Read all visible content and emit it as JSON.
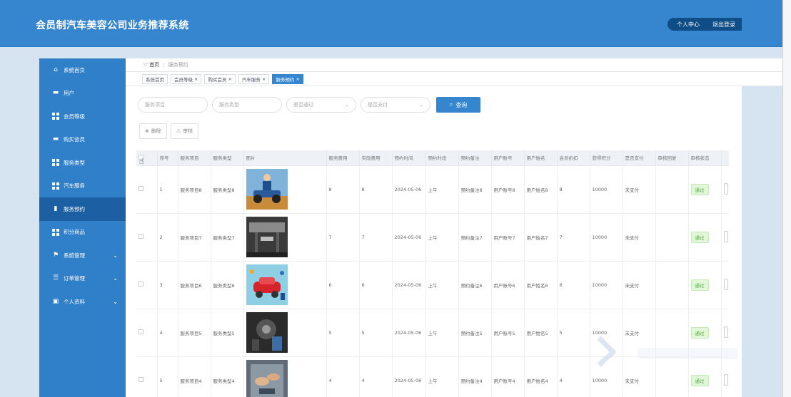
{
  "app": {
    "title": "会员制汽车美容公司业务推荐系统"
  },
  "header": {
    "profile": "个人中心",
    "logout": "退出登录"
  },
  "sidebar": {
    "items": [
      {
        "label": "系统首页",
        "icon": "home-icon"
      },
      {
        "label": "用户",
        "icon": "user-card-icon"
      },
      {
        "label": "会员等级",
        "icon": "grid-icon"
      },
      {
        "label": "购买会员",
        "icon": "user-card-icon"
      },
      {
        "label": "服务类型",
        "icon": "grid-icon"
      },
      {
        "label": "汽车服务",
        "icon": "grid-icon"
      },
      {
        "label": "服务预约",
        "icon": "book-icon",
        "active": true
      },
      {
        "label": "积分商品",
        "icon": "grid-icon"
      },
      {
        "label": "系统管理",
        "icon": "flag-icon",
        "expandable": true
      },
      {
        "label": "订单管理",
        "icon": "sliders-icon",
        "expandable": true
      },
      {
        "label": "个人资料",
        "icon": "wallet-icon",
        "expandable": true
      }
    ]
  },
  "breadcrumb": {
    "home": "首页",
    "current": "服务预约"
  },
  "tags": [
    {
      "label": "系统首页",
      "closable": false
    },
    {
      "label": "会员等级",
      "closable": true
    },
    {
      "label": "购买会员",
      "closable": true
    },
    {
      "label": "汽车服务",
      "closable": true
    },
    {
      "label": "服务预约",
      "closable": true,
      "active": true
    }
  ],
  "search": {
    "service_item_placeholder": "服务项目",
    "service_type_placeholder": "服务类型",
    "passed_placeholder": "是否通过",
    "paid_placeholder": "是否支付",
    "button": "查询"
  },
  "actions": {
    "delete": "删除",
    "review": "审核"
  },
  "table": {
    "headers": [
      "序号",
      "服务项目",
      "服务类型",
      "图片",
      "服务费用",
      "实际费用",
      "预约时间",
      "预约时段",
      "预约备注",
      "用户账号",
      "用户姓名",
      "会员折扣",
      "获得积分",
      "是否支付",
      "审核回复",
      "审核状态"
    ],
    "rows": [
      {
        "no": "1",
        "item": "服务项目8",
        "type": "服务类型8",
        "fee": "8",
        "actual": "8",
        "date": "2024-05-06",
        "period": "上午",
        "remark": "预约备注8",
        "account": "用户账号8",
        "name": "用户姓名8",
        "discount": "8",
        "points": "10000",
        "paid": "未支付",
        "reply": "",
        "status": "通过",
        "pic": "mechanic"
      },
      {
        "no": "2",
        "item": "服务项目7",
        "type": "服务类型7",
        "fee": "7",
        "actual": "7",
        "date": "2024-05-06",
        "period": "上午",
        "remark": "预约备注7",
        "account": "用户账号7",
        "name": "用户姓名7",
        "discount": "7",
        "points": "10000",
        "paid": "未支付",
        "reply": "",
        "status": "通过",
        "pic": "garage"
      },
      {
        "no": "3",
        "item": "服务项目6",
        "type": "服务类型6",
        "fee": "6",
        "actual": "6",
        "date": "2024-05-06",
        "period": "上午",
        "remark": "预约备注6",
        "account": "用户账号6",
        "name": "用户姓名6",
        "discount": "6",
        "points": "10000",
        "paid": "未支付",
        "reply": "",
        "status": "通过",
        "pic": "redcar"
      },
      {
        "no": "4",
        "item": "服务项目5",
        "type": "服务类型5",
        "fee": "5",
        "actual": "5",
        "date": "2024-05-06",
        "period": "上午",
        "remark": "预约备注5",
        "account": "用户账号5",
        "name": "用户姓名5",
        "discount": "5",
        "points": "10000",
        "paid": "未支付",
        "reply": "",
        "status": "通过",
        "pic": "dark"
      },
      {
        "no": "5",
        "item": "服务项目4",
        "type": "服务类型4",
        "fee": "4",
        "actual": "4",
        "date": "2024-05-06",
        "period": "上午",
        "remark": "预约备注4",
        "account": "用户账号4",
        "name": "用户姓名4",
        "discount": "4",
        "points": "10000",
        "paid": "未支付",
        "reply": "",
        "status": "通过",
        "pic": "hands"
      }
    ]
  },
  "colors": {
    "header": "#3585cf",
    "sidebar": "#2f7fc9",
    "sidebar_active": "#1d5fa3",
    "status_green": "#4caf36"
  }
}
